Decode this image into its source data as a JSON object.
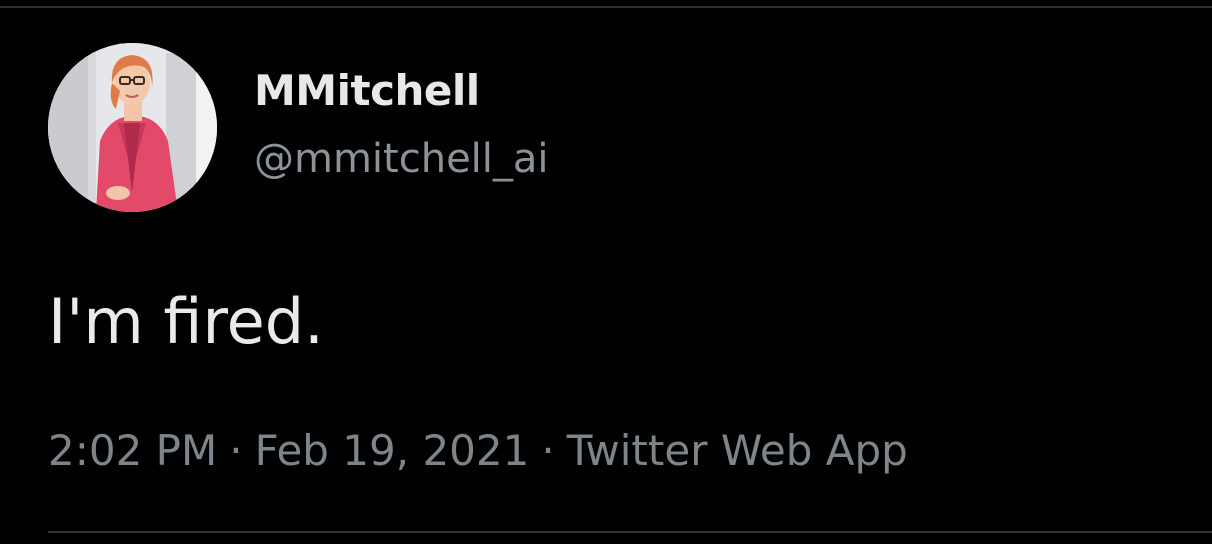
{
  "tweet": {
    "author": {
      "display_name": "MMitchell",
      "handle": "@mmitchell_ai",
      "avatar_icon": "user-avatar"
    },
    "text": "I'm fired.",
    "time": "2:02 PM",
    "date": "Feb 19, 2021",
    "separator": "·",
    "source": "Twitter Web App"
  },
  "colors": {
    "background": "#000000",
    "primary_text": "#e7e9ea",
    "secondary_text": "#7d858b",
    "divider": "#2f3336"
  }
}
